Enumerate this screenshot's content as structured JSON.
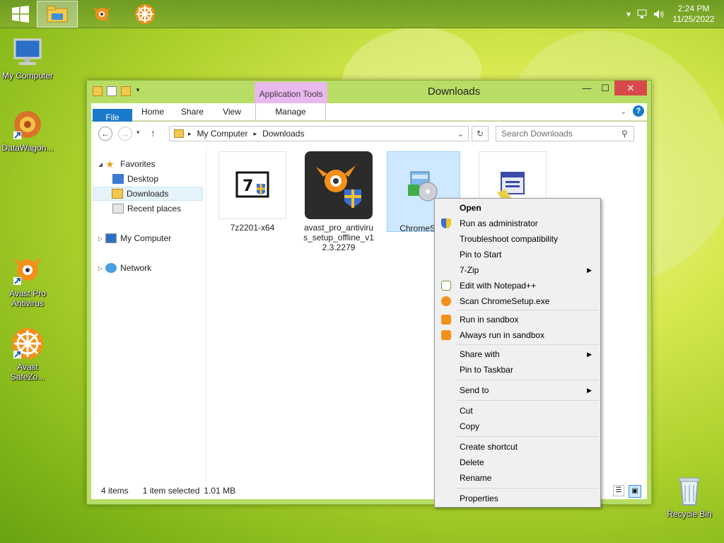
{
  "taskbar": {
    "clock_time": "2:24 PM",
    "clock_date": "11/25/2022",
    "icons": [
      "windows-start-icon",
      "file-explorer-icon",
      "avast-icon",
      "safezone-icon"
    ]
  },
  "desktop": {
    "icons": [
      {
        "label": "My Computer"
      },
      {
        "label": "DataWagon..."
      },
      {
        "label": "Avast Pro Antivirus"
      },
      {
        "label": "Avast SafeZo..."
      },
      {
        "label": "Recycle Bin"
      }
    ]
  },
  "window": {
    "title": "Downloads",
    "contextual_tab": "Application Tools",
    "ribbon_tabs": [
      "File",
      "Home",
      "Share",
      "View",
      "Manage"
    ],
    "address": {
      "root": "My Computer",
      "current": "Downloads"
    },
    "search_placeholder": "Search Downloads",
    "nav": {
      "favorites": "Favorites",
      "desktop": "Desktop",
      "downloads": "Downloads",
      "recent": "Recent places",
      "computer": "My Computer",
      "network": "Network"
    },
    "files": [
      {
        "name": "7z2201-x64"
      },
      {
        "name": "avast_pro_antivirus_setup_offline_v12.3.2279"
      },
      {
        "name": "ChromeSe..."
      },
      {
        "name": ""
      }
    ],
    "status": {
      "items": "4 items",
      "selected": "1 item selected",
      "size": "1.01 MB"
    }
  },
  "context_menu": {
    "items": [
      {
        "label": "Open",
        "bold": true
      },
      {
        "label": "Run as administrator",
        "icon": "uac-shield-icon"
      },
      {
        "label": "Troubleshoot compatibility"
      },
      {
        "label": "Pin to Start"
      },
      {
        "label": "7-Zip",
        "submenu": true
      },
      {
        "label": "Edit with Notepad++",
        "icon": "notepad-plus-icon"
      },
      {
        "label": "Scan ChromeSetup.exe",
        "icon": "avast-scan-icon"
      },
      {
        "label": "Run in sandbox",
        "icon": "sandbox-icon"
      },
      {
        "label": "Always run in sandbox",
        "icon": "sandbox-check-icon"
      },
      {
        "label": "Share with",
        "submenu": true
      },
      {
        "label": "Pin to Taskbar"
      },
      {
        "label": "Send to",
        "submenu": true
      },
      {
        "label": "Cut"
      },
      {
        "label": "Copy"
      },
      {
        "label": "Create shortcut"
      },
      {
        "label": "Delete"
      },
      {
        "label": "Rename"
      },
      {
        "label": "Properties"
      }
    ]
  },
  "colors": {
    "accent": "#1979ca",
    "contextual_tab": "#e9b8ee",
    "close_button": "#d9484a",
    "selection": "#cde8ff",
    "avast_orange": "#f39019"
  }
}
